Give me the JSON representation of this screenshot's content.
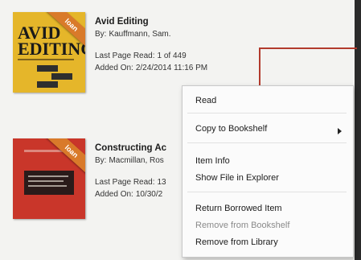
{
  "books": [
    {
      "title": "Avid Editing",
      "author_label": "By:",
      "author": "Kauffmann, Sam.",
      "last_page_label": "Last Page Read:",
      "last_page": "1 of 449",
      "added_label": "Added On:",
      "added": "2/24/2014 11:16 PM",
      "ribbon": "loan",
      "cover_text": "AVID EDITING"
    },
    {
      "title": "Constructing Ac",
      "author_label": "By:",
      "author": "Macmillan, Ros",
      "last_page_label": "Last Page Read:",
      "last_page": "13",
      "added_label": "Added On:",
      "added": "10/30/2",
      "ribbon": "loan"
    }
  ],
  "context_menu": {
    "items": [
      {
        "label": "Read"
      },
      {
        "label": "Copy to Bookshelf"
      },
      {
        "label": "Item Info"
      },
      {
        "label": "Show File in Explorer"
      },
      {
        "label": "Return Borrowed Item"
      },
      {
        "label": "Remove from Bookshelf",
        "disabled": true
      },
      {
        "label": "Remove from Library"
      }
    ]
  },
  "colors": {
    "accent": "#b23b2d",
    "ribbon": "#d97a2a",
    "cover1": "#e5b62a",
    "cover2": "#c9362a"
  }
}
